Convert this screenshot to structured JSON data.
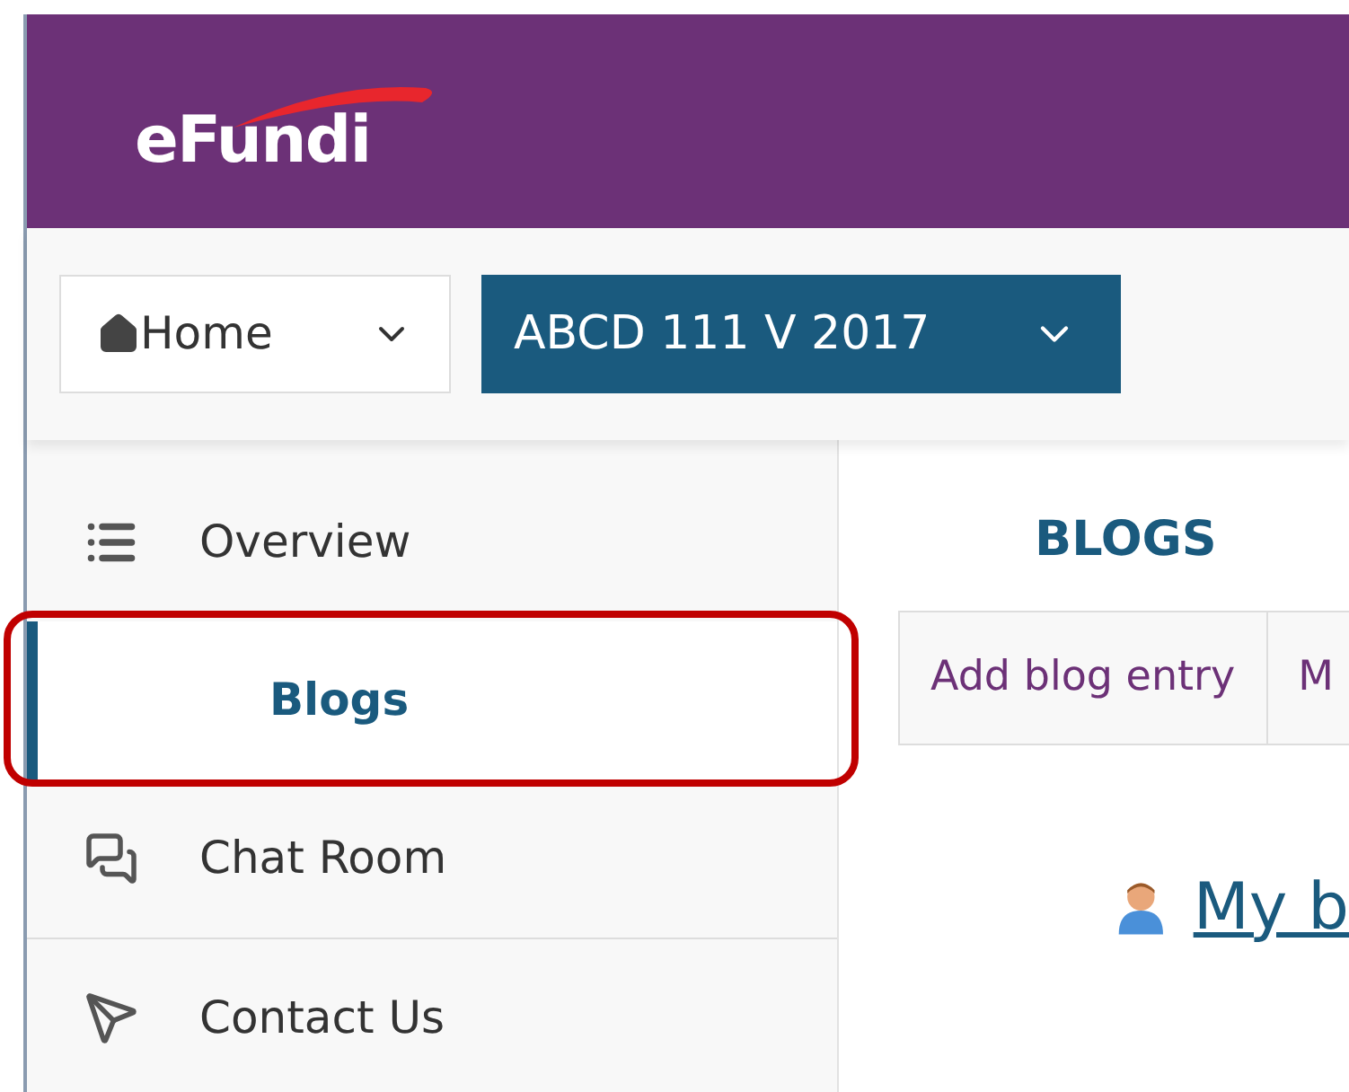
{
  "header": {
    "logo": "eFundi"
  },
  "nav": {
    "home": {
      "label": "Home"
    },
    "site": {
      "label": "ABCD 111 V 2017"
    }
  },
  "sidebar": {
    "items": [
      {
        "label": "Overview",
        "selected": false,
        "highlighted": false
      },
      {
        "label": "Blogs",
        "selected": true,
        "highlighted": true
      },
      {
        "label": "Chat Room",
        "selected": false,
        "highlighted": false
      },
      {
        "label": "Contact Us",
        "selected": false,
        "highlighted": false
      }
    ]
  },
  "main": {
    "title": "BLOGS",
    "toolbar": [
      "Add blog entry",
      "M"
    ],
    "link": "My b"
  }
}
